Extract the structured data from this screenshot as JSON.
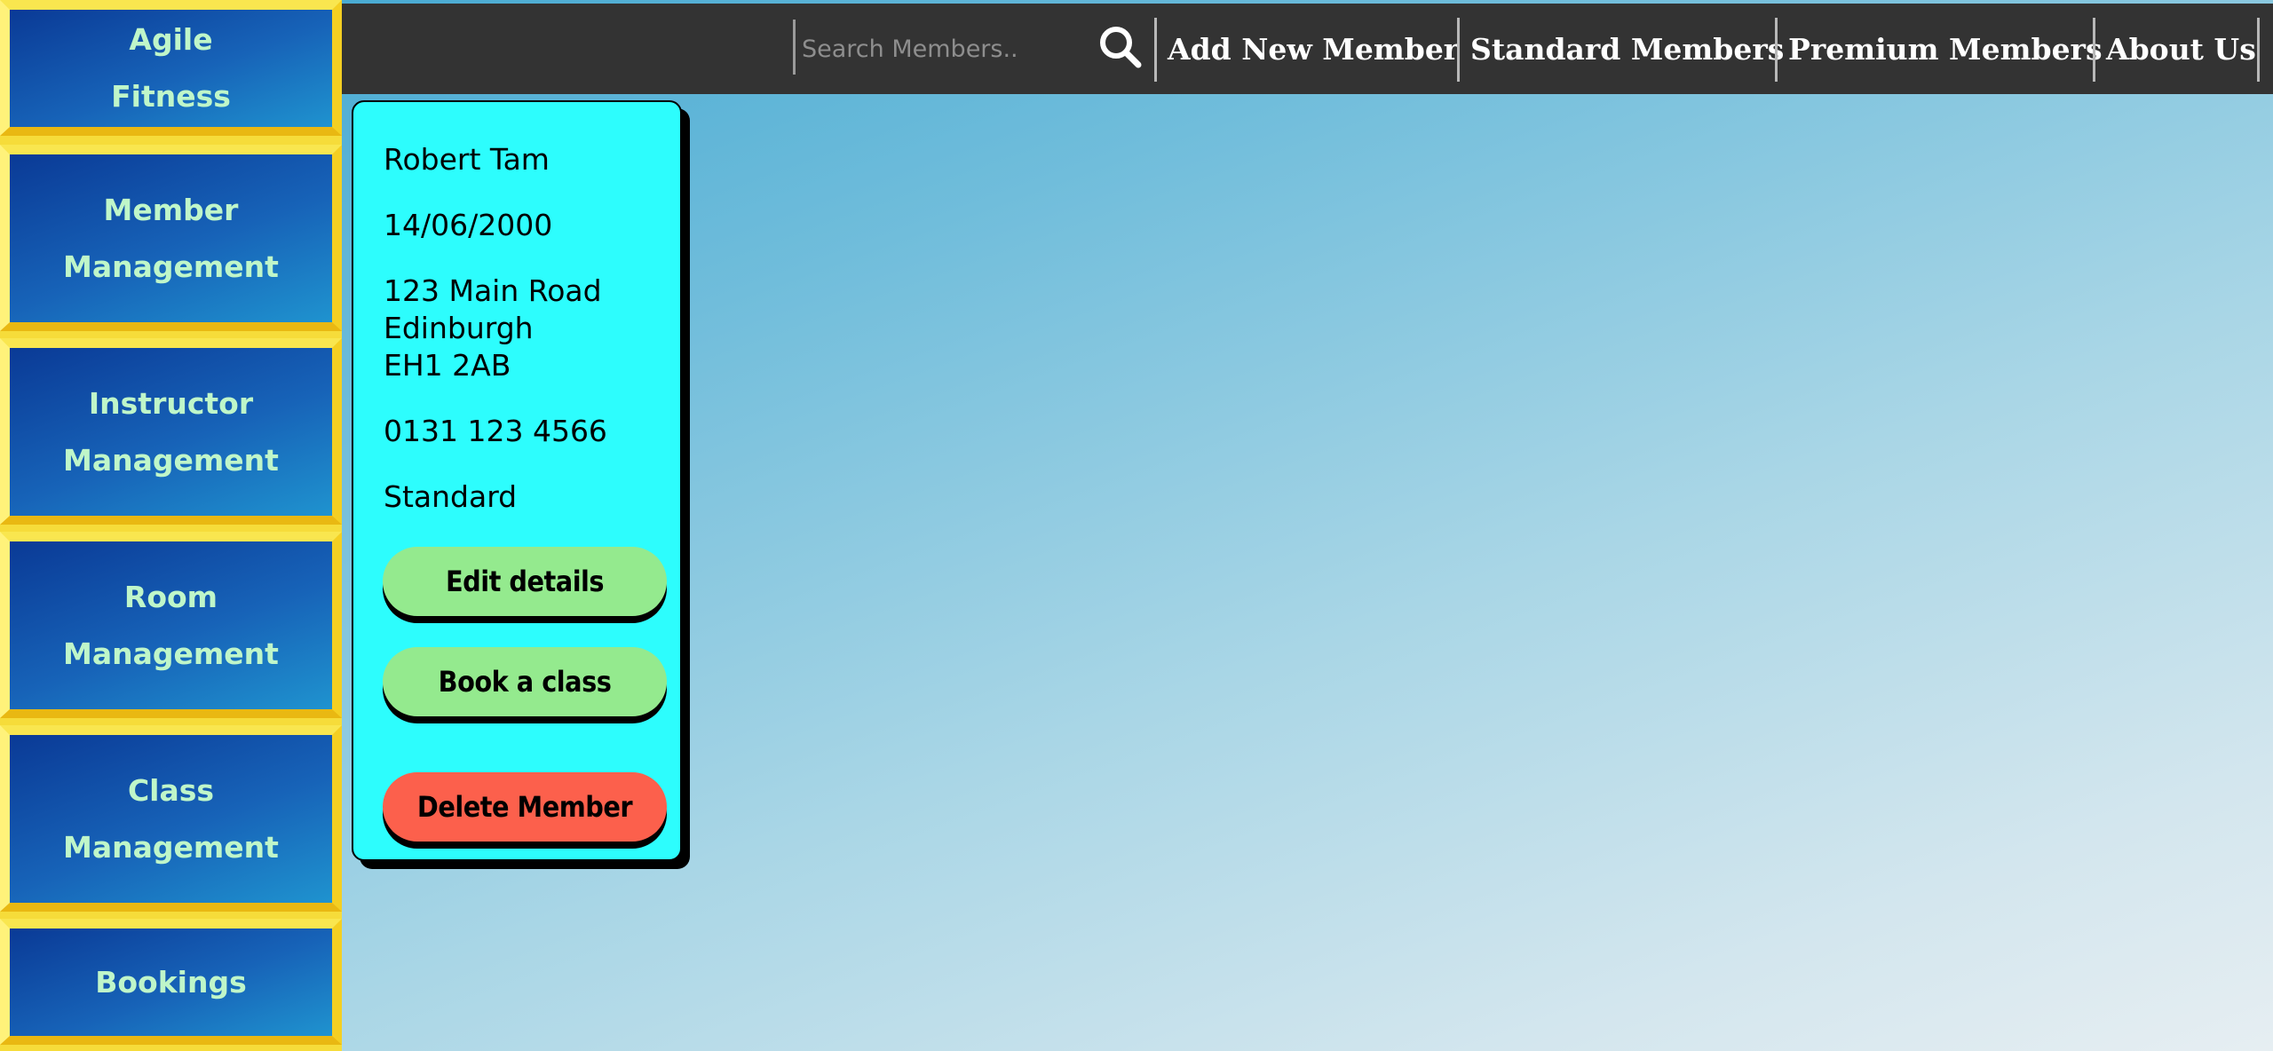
{
  "sidebar": {
    "items": [
      {
        "line1": "Agile",
        "line2": "Fitness"
      },
      {
        "line1": "Member",
        "line2": "Management"
      },
      {
        "line1": "Instructor",
        "line2": "Management"
      },
      {
        "line1": "Room",
        "line2": "Management"
      },
      {
        "line1": "Class",
        "line2": "Management"
      },
      {
        "line1": "Bookings",
        "line2": ""
      }
    ]
  },
  "topbar": {
    "search_placeholder": "Search Members..",
    "search_icon": "magnifying-glass",
    "nav": [
      "Add New Member",
      "Standard Members",
      "Premium Members",
      "About Us"
    ]
  },
  "member": {
    "name": "Robert Tam",
    "dob": "14/06/2000",
    "address": {
      "line1": "123 Main Road",
      "line2": "Edinburgh",
      "line3": "EH1 2AB"
    },
    "phone": "0131 123 4566",
    "membership": "Standard",
    "actions": {
      "edit": "Edit details",
      "book": "Book a class",
      "delete": "Delete Member"
    }
  },
  "colors": {
    "sidebar_border": "#f6dc3a",
    "sidebar_text": "#bff6c9",
    "topbar": "#333333",
    "card": "#2dfdfd",
    "button_green": "#94ea8e",
    "button_red": "#fc604c"
  }
}
